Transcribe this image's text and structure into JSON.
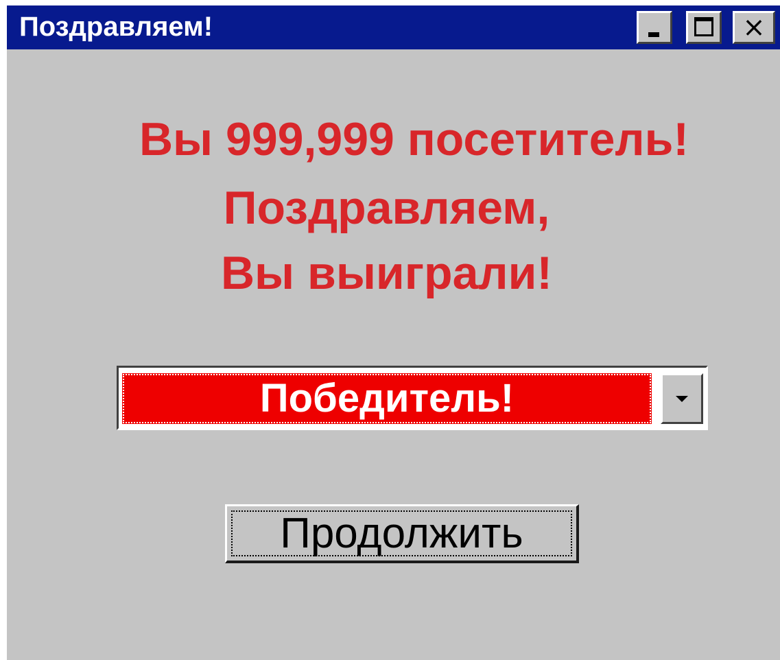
{
  "window": {
    "title": "Поздравляем!",
    "controls": {
      "minimize": "minimize-icon",
      "maximize": "maximize-icon",
      "close_glyph": "×"
    },
    "colors": {
      "titlebar": "#071a8e",
      "client": "#c4c4c4"
    }
  },
  "message": {
    "line1": "Вы 999,999 посетитель!",
    "line2": "Поздравляем,",
    "line3": "Вы выиграли!",
    "color": "#d8262a"
  },
  "combo": {
    "selected_value": "Победитель!",
    "arrow_icon": "chevron-down-icon",
    "highlight_color": "#ee0000"
  },
  "continue_button": {
    "label": "Продолжить"
  }
}
